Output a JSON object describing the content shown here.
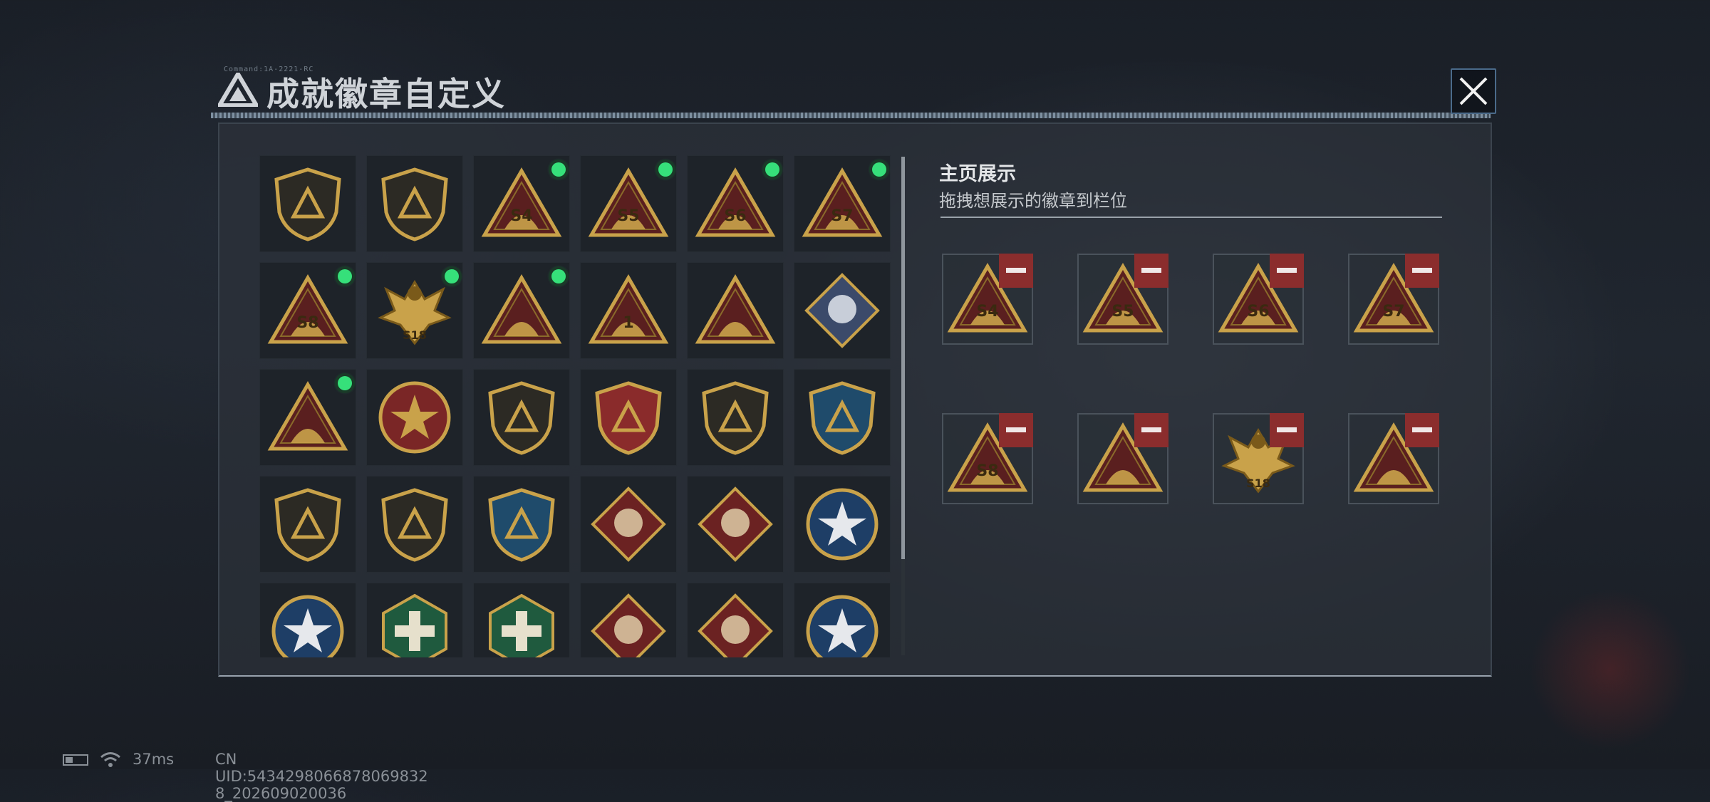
{
  "header": {
    "title": "成就徽章自定义",
    "tiny_label": "Command:1A-2221-RC"
  },
  "showcase": {
    "title": "主页展示",
    "subtitle": "拖拽想展示的徽章到栏位",
    "slots": [
      {
        "badge": "s4-badge",
        "label": "S4"
      },
      {
        "badge": "s5-badge",
        "label": "S5"
      },
      {
        "badge": "s6-badge",
        "label": "S6"
      },
      {
        "badge": "s7-badge",
        "label": "S7"
      },
      {
        "badge": "s8-badge",
        "label": "S8"
      },
      {
        "badge": "diver-badge",
        "label": ""
      },
      {
        "badge": "phoenix-badge",
        "label": "S18"
      },
      {
        "badge": "bird-badge",
        "label": ""
      }
    ]
  },
  "badges": [
    {
      "name": "delta-shield-badge",
      "shape": "shield",
      "label": "",
      "new": false
    },
    {
      "name": "helicopter-badge",
      "shape": "shield",
      "label": "",
      "new": false
    },
    {
      "name": "s4-badge",
      "shape": "triangle",
      "label": "S4",
      "new": true
    },
    {
      "name": "s5-badge",
      "shape": "triangle",
      "label": "S5",
      "new": true
    },
    {
      "name": "s6-badge",
      "shape": "triangle",
      "label": "S6",
      "new": true
    },
    {
      "name": "s7-badge",
      "shape": "triangle",
      "label": "S7",
      "new": true
    },
    {
      "name": "s8-badge",
      "shape": "triangle",
      "label": "S8",
      "new": true
    },
    {
      "name": "phoenix-badge",
      "shape": "phoenix",
      "label": "S18",
      "new": true
    },
    {
      "name": "bird-badge",
      "shape": "triangle",
      "label": "",
      "new": true
    },
    {
      "name": "number-one-badge",
      "shape": "triangle",
      "label": "1",
      "new": false
    },
    {
      "name": "soldiers-badge",
      "shape": "triangle",
      "label": "",
      "new": false
    },
    {
      "name": "rose-badge",
      "shape": "diamond-blue",
      "label": "",
      "new": false
    },
    {
      "name": "diver-badge",
      "shape": "triangle",
      "label": "",
      "new": true
    },
    {
      "name": "star-wreath-badge",
      "shape": "round-red",
      "label": "",
      "new": false
    },
    {
      "name": "chevron-shield-badge",
      "shape": "shield",
      "label": "",
      "new": false
    },
    {
      "name": "eagle-shield-badge",
      "shape": "shield-red",
      "label": "",
      "new": false
    },
    {
      "name": "dice-shield-badge",
      "shape": "shield",
      "label": "",
      "new": false
    },
    {
      "name": "sniper-badge",
      "shape": "shield-blue",
      "label": "",
      "new": false
    },
    {
      "name": "rifle-shield-badge",
      "shape": "shield",
      "label": "",
      "new": false
    },
    {
      "name": "knife-shield-badge",
      "shape": "shield",
      "label": "",
      "new": false
    },
    {
      "name": "crosshair-badge",
      "shape": "shield-blue",
      "label": "",
      "new": false
    },
    {
      "name": "wolf-red-badge",
      "shape": "diamond-red",
      "label": "",
      "new": false
    },
    {
      "name": "wolf-red-badge-2",
      "shape": "diamond-red",
      "label": "",
      "new": false
    },
    {
      "name": "eagle-blue-badge",
      "shape": "round-blue",
      "label": "",
      "new": false
    },
    {
      "name": "eagle-blue-badge-2",
      "shape": "round-blue",
      "label": "",
      "new": false
    },
    {
      "name": "wasp-badge",
      "shape": "hex-green",
      "label": "",
      "new": false
    },
    {
      "name": "medic-badge",
      "shape": "hex-green",
      "label": "",
      "new": false
    },
    {
      "name": "dragon-badge",
      "shape": "diamond-red",
      "label": "",
      "new": false
    },
    {
      "name": "runner-badge",
      "shape": "diamond-red",
      "label": "",
      "new": false
    },
    {
      "name": "lynx-badge",
      "shape": "round-blue",
      "label": "",
      "new": false
    }
  ],
  "footer": {
    "ping": "37ms",
    "uid": "CN UID:5434298066878069832​8_202609020036"
  },
  "colors": {
    "accent_green": "#36e07a",
    "remove_red": "#8b2d2d",
    "gold": "#c9a24a"
  }
}
